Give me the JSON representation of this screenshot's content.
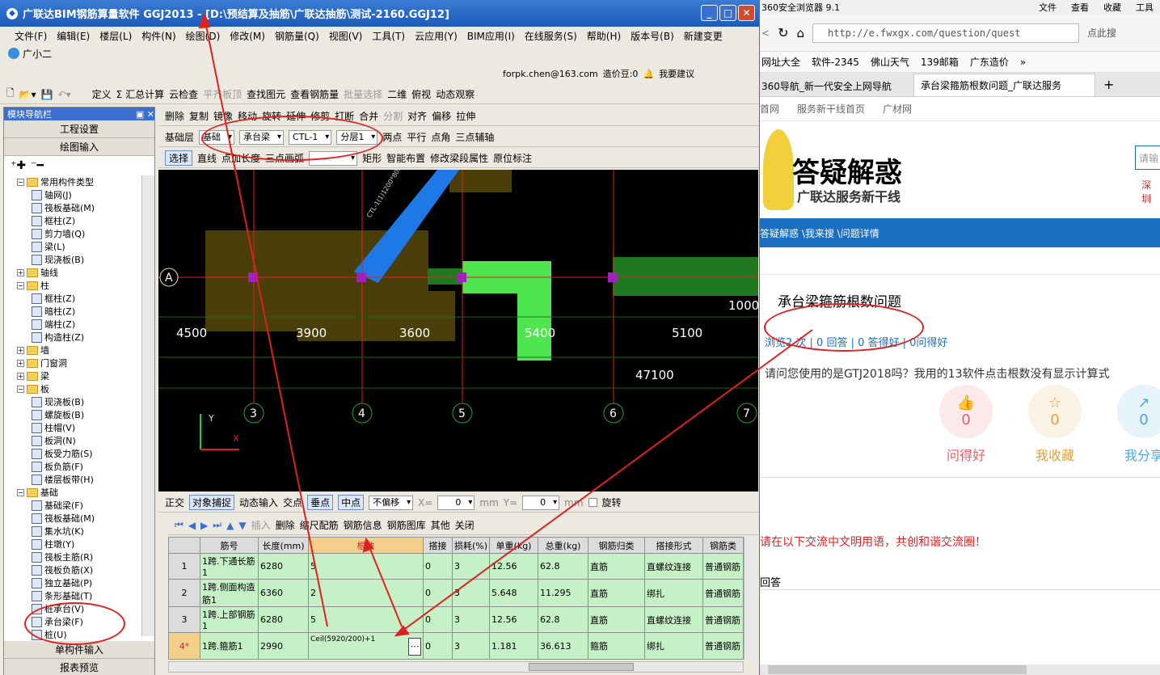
{
  "window": {
    "title": "广联达BIM钢筋算量软件 GGJ2013 - [D:\\预结算及抽筋\\广联达抽筋\\测试-2160.GGJ12]",
    "min": "_",
    "max": "□",
    "close": "✕"
  },
  "menu": [
    "文件(F)",
    "编辑(E)",
    "楼层(L)",
    "构件(N)",
    "绘图(D)",
    "修改(M)",
    "钢筋量(Q)",
    "视图(V)",
    "工具(T)",
    "云应用(Y)",
    "BIM应用(I)",
    "在线服务(S)",
    "帮助(H)",
    "版本号(B)",
    "新建变更"
  ],
  "user": {
    "name": "广小二",
    "email": "forpk.chen@163.com",
    "cost": "造价豆:0",
    "suggest": "我要建议"
  },
  "toolbar1": [
    "定义",
    "Σ 汇总计算",
    "云检查",
    "平齐板顶",
    "查找图元",
    "查看钢筋量",
    "批量选择",
    "二维",
    "俯视",
    "动态观察"
  ],
  "toolbar2": [
    "删除",
    "复制",
    "镜像",
    "移动",
    "旋转",
    "延伸",
    "修剪",
    "打断",
    "合并",
    "分割",
    "对齐",
    "偏移",
    "拉伸"
  ],
  "toolbar3": {
    "floor": "基础层",
    "type": "基础",
    "comp": "承台梁",
    "name": "CTL-1",
    "layer": "分层1",
    "items": [
      "两点",
      "平行",
      "点角",
      "三点辅轴"
    ]
  },
  "toolbar4": [
    "选择",
    "直线",
    "点加长度",
    "三点画弧",
    "矩形",
    "智能布置",
    "修改梁段属性",
    "原位标注"
  ],
  "nav": {
    "header": "模块导航栏",
    "pin": "▣",
    "close": "✕",
    "proj": "工程设置",
    "draw": "绘图输入",
    "single": "单构件输入",
    "report": "报表预览"
  },
  "tree": [
    {
      "lvl": 0,
      "t": "folder",
      "ex": "−",
      "label": "常用构件类型"
    },
    {
      "lvl": 1,
      "label": "轴网(J)"
    },
    {
      "lvl": 1,
      "label": "筏板基础(M)"
    },
    {
      "lvl": 1,
      "label": "框柱(Z)"
    },
    {
      "lvl": 1,
      "label": "剪力墙(Q)"
    },
    {
      "lvl": 1,
      "label": "梁(L)"
    },
    {
      "lvl": 1,
      "label": "现浇板(B)"
    },
    {
      "lvl": 0,
      "t": "folder",
      "ex": "+",
      "label": "轴线"
    },
    {
      "lvl": 0,
      "t": "folder",
      "ex": "−",
      "label": "柱"
    },
    {
      "lvl": 1,
      "label": "框柱(Z)"
    },
    {
      "lvl": 1,
      "label": "暗柱(Z)"
    },
    {
      "lvl": 1,
      "label": "端柱(Z)"
    },
    {
      "lvl": 1,
      "label": "构造柱(Z)"
    },
    {
      "lvl": 0,
      "t": "folder",
      "ex": "+",
      "label": "墙"
    },
    {
      "lvl": 0,
      "t": "folder",
      "ex": "+",
      "label": "门窗洞"
    },
    {
      "lvl": 0,
      "t": "folder",
      "ex": "+",
      "label": "梁"
    },
    {
      "lvl": 0,
      "t": "folder",
      "ex": "−",
      "label": "板"
    },
    {
      "lvl": 1,
      "label": "现浇板(B)"
    },
    {
      "lvl": 1,
      "label": "螺旋板(B)"
    },
    {
      "lvl": 1,
      "label": "柱帽(V)"
    },
    {
      "lvl": 1,
      "label": "板洞(N)"
    },
    {
      "lvl": 1,
      "label": "板受力筋(S)"
    },
    {
      "lvl": 1,
      "label": "板负筋(F)"
    },
    {
      "lvl": 1,
      "label": "楼层板带(H)"
    },
    {
      "lvl": 0,
      "t": "folder",
      "ex": "−",
      "label": "基础"
    },
    {
      "lvl": 1,
      "label": "基础梁(F)"
    },
    {
      "lvl": 1,
      "label": "筏板基础(M)"
    },
    {
      "lvl": 1,
      "label": "集水坑(K)"
    },
    {
      "lvl": 1,
      "label": "柱墩(Y)"
    },
    {
      "lvl": 1,
      "label": "筏板主筋(R)"
    },
    {
      "lvl": 1,
      "label": "筏板负筋(X)"
    },
    {
      "lvl": 1,
      "label": "独立基础(P)"
    },
    {
      "lvl": 1,
      "label": "条形基础(T)"
    },
    {
      "lvl": 1,
      "label": "桩承台(V)"
    },
    {
      "lvl": 1,
      "label": "承台梁(F)"
    },
    {
      "lvl": 1,
      "label": "桩(U)"
    }
  ],
  "cad": {
    "axisA": "A",
    "dims": [
      "4500",
      "3900",
      "3600",
      "5400",
      "5100",
      "1000",
      "47100"
    ],
    "axes": [
      "3",
      "4",
      "5",
      "6",
      "7"
    ],
    "beamlabel": "CTL-1(1)1200*800"
  },
  "snapbar": [
    "正交",
    "对象捕捉",
    "动态输入",
    "交点",
    "垂点",
    "中点",
    "不偏移",
    "X=",
    "0",
    "mm",
    "Y=",
    "0",
    "mm",
    "旋转"
  ],
  "rebarbar": [
    "插入",
    "删除",
    "缩尺配筋",
    "钢筋信息",
    "钢筋图库",
    "其他",
    "关闭"
  ],
  "table": {
    "headers": [
      "筋号",
      "长度(mm)",
      "根数",
      "搭接",
      "损耗(%)",
      "单重(kg)",
      "总重(kg)",
      "钢筋归类",
      "搭接形式",
      "钢筋类"
    ],
    "rows": [
      {
        "n": "1",
        "c": [
          "1跨.下通长筋1",
          "6280",
          "5",
          "0",
          "3",
          "12.56",
          "62.8",
          "直筋",
          "直螺纹连接",
          "普通钢筋"
        ]
      },
      {
        "n": "2",
        "c": [
          "1跨.侧面构造筋1",
          "6360",
          "2",
          "0",
          "3",
          "5.648",
          "11.295",
          "直筋",
          "绑扎",
          "普通钢筋"
        ]
      },
      {
        "n": "3",
        "c": [
          "1跨.上部钢筋1",
          "6280",
          "5",
          "0",
          "3",
          "12.56",
          "62.8",
          "直筋",
          "直螺纹连接",
          "普通钢筋"
        ]
      },
      {
        "n": "4*",
        "c": [
          "1跨.箍筋1",
          "2990",
          "Ceil(5920/200)+1",
          "0",
          "3",
          "1.181",
          "36.613",
          "箍筋",
          "绑扎",
          "普通钢筋"
        ]
      }
    ]
  },
  "browser": {
    "name": "360安全浏览器 9.1",
    "menu": [
      "文件",
      "查看",
      "收藏",
      "工具"
    ],
    "url": "http://e.fwxgx.com/question/quest",
    "search": "点此搜",
    "bookmarks": [
      "网址大全",
      "软件-2345",
      "佛山天气",
      "139邮箱",
      "广东造价"
    ],
    "tabs": [
      "360导航_新一代安全上网导航",
      "承台梁箍筋根数问题_广联达服务"
    ],
    "topnav": [
      "首网",
      "服务新干线首页",
      "广材网"
    ],
    "logo": "答疑解惑",
    "logosub": "广联达服务新干线",
    "searchph": "请输",
    "city": "深圳",
    "crumb": "答疑解惑 \\我来搜 \\问题详情",
    "qtitle": "承台梁箍筋根数问题",
    "stats": "浏览2 次 | 0 回答 | 0 答得好 | 0问得好",
    "qbody": "请问您使用的是GTJ2018吗？我用的13软件点击根数没有显示计算式",
    "actions": [
      {
        "v": "0",
        "l": "问得好",
        "c": "#e8606a"
      },
      {
        "v": "0",
        "l": "我收藏",
        "c": "#e0a040"
      },
      {
        "v": "0",
        "l": "我分享",
        "c": "#4aa8e0"
      }
    ],
    "notice": "请在以下交流中文明用语，共创和谐交流圈！",
    "answer": "回答"
  }
}
